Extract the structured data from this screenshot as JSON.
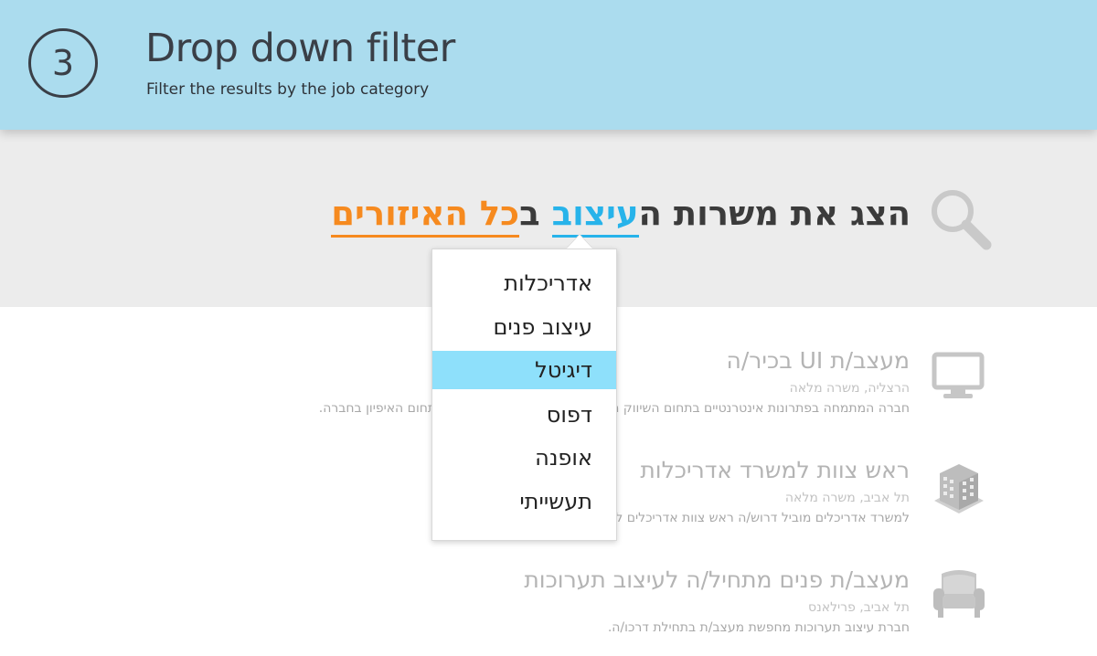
{
  "header": {
    "step_number": "3",
    "title": "Drop down filter",
    "subtitle": "Filter the results by the job category",
    "background_color": "#abdcee"
  },
  "search": {
    "icon": "search-icon",
    "prefix": "הצג את משרות ה",
    "category": "עיצוב",
    "connector": " ב",
    "location": "כל האיזורים",
    "category_color": "#27b3ea",
    "location_color": "#f68a1f"
  },
  "dropdown": {
    "items": [
      {
        "label": "אדריכלות",
        "selected": false
      },
      {
        "label": "עיצוב פנים",
        "selected": false
      },
      {
        "label": "דיגיטל",
        "selected": true
      },
      {
        "label": "דפוס",
        "selected": false
      },
      {
        "label": "אופנה",
        "selected": false
      },
      {
        "label": "תעשייתי",
        "selected": false
      }
    ],
    "highlight_color": "#8ee0fb"
  },
  "jobs": [
    {
      "icon": "monitor-icon",
      "title": "מעצב/ת UI בכיר/ה",
      "meta": "הרצליה, משרה מלאה",
      "description": "חברה המתמחה בפתרונות אינטרנטיים בתחום השיווק מחפשת מעצב UI לריכוז והבלת התחום האיפיון בחברה."
    },
    {
      "icon": "building-icon",
      "title": "ראש צוות למשרד אדריכלות",
      "meta": "תל אביב, משרה מלאה",
      "description": "למשרד אדריכלים מוביל דרוש/ה ראש צוות אדריכלים לניהול של כ-4 אדריכלים."
    },
    {
      "icon": "armchair-icon",
      "title": "מעצב/ת פנים מתחיל/ה לעיצוב תערוכות",
      "meta": "תל אביב, פרילאנס",
      "description": "חברת עיצוב תערוכות מחפשת מעצב/ת בתחילת דרכו/ה."
    }
  ]
}
